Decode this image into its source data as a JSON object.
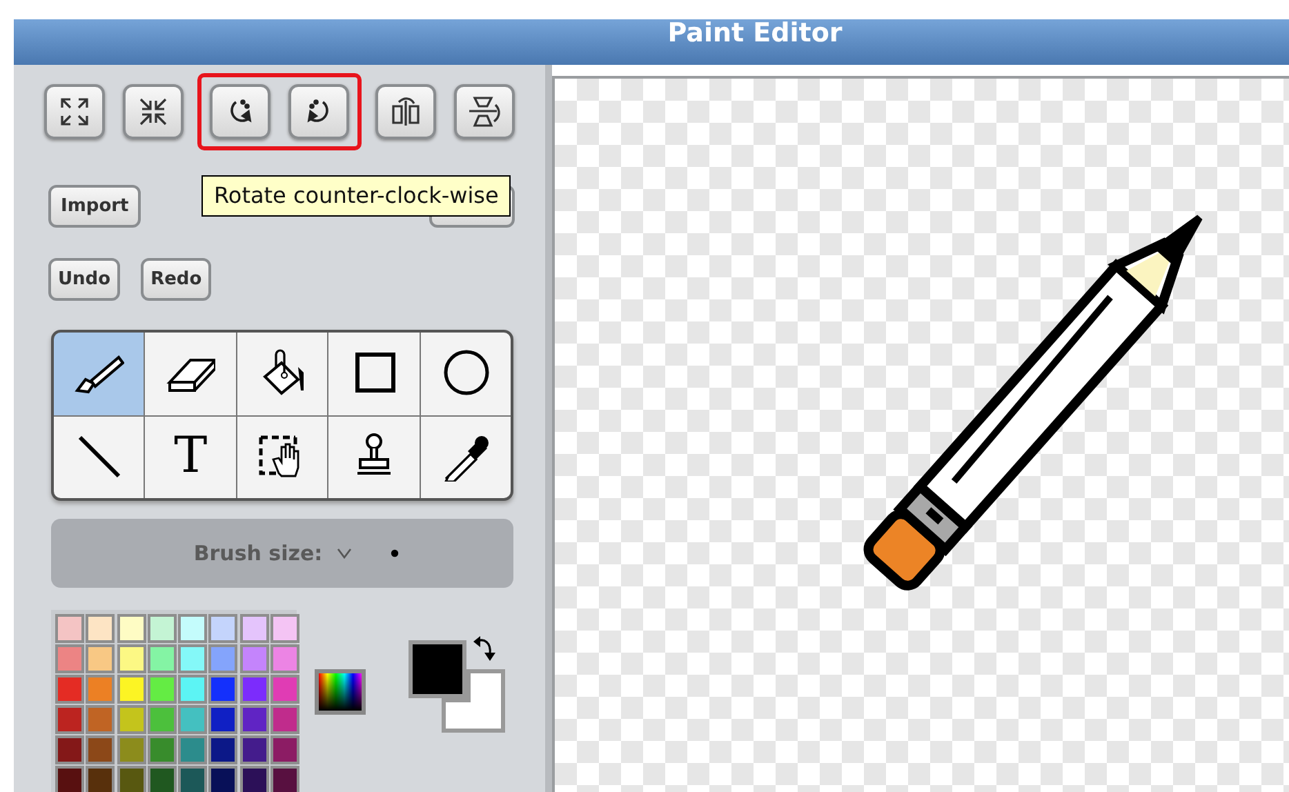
{
  "window": {
    "title": "Paint Editor"
  },
  "transform_button_pairs": [
    {
      "highlighted": false
    },
    {
      "highlighted": true
    },
    {
      "highlighted": false
    }
  ],
  "tooltip": "Rotate counter-clock-wise",
  "import_button": "Import",
  "history_buttons": [
    "Undo",
    "Redo"
  ],
  "tools": [
    {
      "selected": true
    },
    {
      "selected": false
    },
    {
      "selected": false
    },
    {
      "selected": false
    },
    {
      "selected": false
    },
    {
      "selected": false
    },
    {
      "selected": false,
      "glyph": "T"
    },
    {
      "selected": false
    },
    {
      "selected": false
    },
    {
      "selected": false
    }
  ],
  "brush_size": {
    "label": "Brush size:"
  },
  "palette": [
    {
      "color": "#f4c4c4"
    },
    {
      "color": "#fde4c4"
    },
    {
      "color": "#fefcc4"
    },
    {
      "color": "#c4f4d4"
    },
    {
      "color": "#c4fcfc"
    },
    {
      "color": "#c4d4fc"
    },
    {
      "color": "#e4c4fc"
    },
    {
      "color": "#f4c4f4"
    },
    {
      "color": "#ec8484"
    },
    {
      "color": "#f8c884"
    },
    {
      "color": "#fcf884"
    },
    {
      "color": "#84f4a4"
    },
    {
      "color": "#84f8f8"
    },
    {
      "color": "#84a4fc"
    },
    {
      "color": "#c484fc"
    },
    {
      "color": "#ec84e4"
    },
    {
      "color": "#e42c24"
    },
    {
      "color": "#ec8024"
    },
    {
      "color": "#fcf424"
    },
    {
      "color": "#64ec44"
    },
    {
      "color": "#5cf4f4"
    },
    {
      "color": "#1430fc"
    },
    {
      "color": "#7c2cfc"
    },
    {
      "color": "#e03cb4"
    },
    {
      "color": "#bc2420"
    },
    {
      "color": "#c06424"
    },
    {
      "color": "#c4c41c"
    },
    {
      "color": "#4cc03c"
    },
    {
      "color": "#44c0c0"
    },
    {
      "color": "#1020c4"
    },
    {
      "color": "#6024c4"
    },
    {
      "color": "#c02c8c"
    },
    {
      "color": "#841818"
    },
    {
      "color": "#8c4818"
    },
    {
      "color": "#8c8c1c"
    },
    {
      "color": "#388c2c"
    },
    {
      "color": "#2c8c8c"
    },
    {
      "color": "#0c1888"
    },
    {
      "color": "#441c8c"
    },
    {
      "color": "#8c1c64"
    },
    {
      "color": "#581010"
    },
    {
      "color": "#58300c"
    },
    {
      "color": "#585810"
    },
    {
      "color": "#205820"
    },
    {
      "color": "#1c5858"
    },
    {
      "color": "#081058"
    },
    {
      "color": "#2c1058"
    },
    {
      "color": "#581040"
    }
  ],
  "foreground": {
    "color": "#000000"
  },
  "background": {
    "color": "#ffffff"
  }
}
